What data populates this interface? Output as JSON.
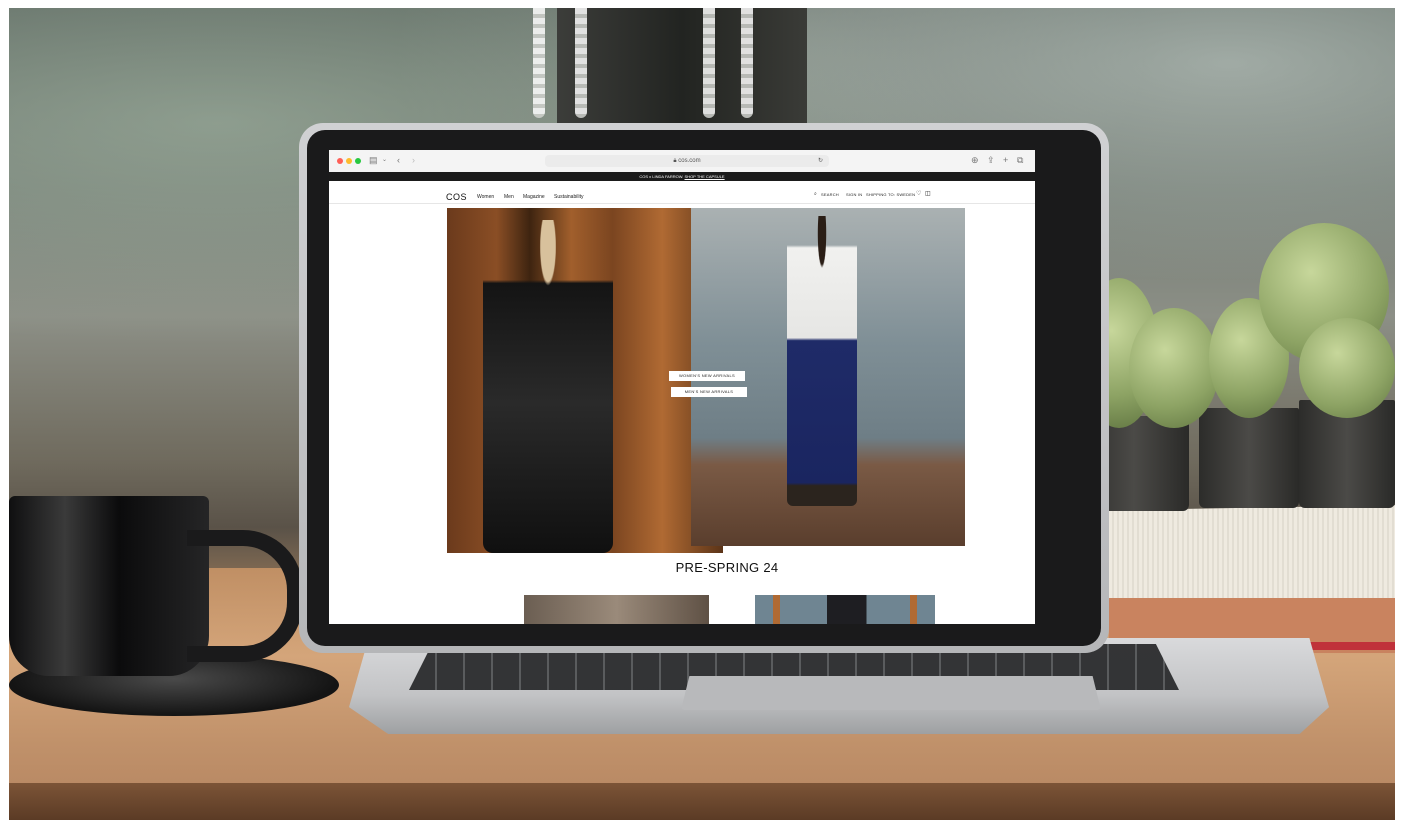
{
  "browser": {
    "url": "cos.com"
  },
  "announcement": {
    "text": "COS x LINDA FARROW.",
    "link": "SHOP THE CAPSULE"
  },
  "nav": {
    "logo": "COS",
    "links": [
      "Women",
      "Men",
      "Magazine",
      "Sustainability"
    ],
    "search_label": "SEARCH",
    "sign_in_label": "SIGN IN",
    "shipping_label": "SHIPPING TO: SWEDEN"
  },
  "hero": {
    "cta_women": "WOMEN'S NEW ARRIVALS",
    "cta_men": "MEN'S NEW ARRIVALS"
  },
  "section": {
    "title": "PRE-SPRING 24"
  },
  "colors": {
    "traffic_red": "#ff5f57",
    "traffic_yellow": "#febc2e",
    "traffic_green": "#28c840",
    "announce_bg": "#1b1b1b",
    "trouser_blue": "#1f2b68"
  },
  "icons": [
    "sidebar-icon",
    "chevron-down-icon",
    "back-icon",
    "forward-icon",
    "lock-icon",
    "reload-icon",
    "download-icon",
    "share-icon",
    "plus-icon",
    "tabs-icon",
    "search-icon",
    "heart-icon",
    "bag-icon"
  ]
}
